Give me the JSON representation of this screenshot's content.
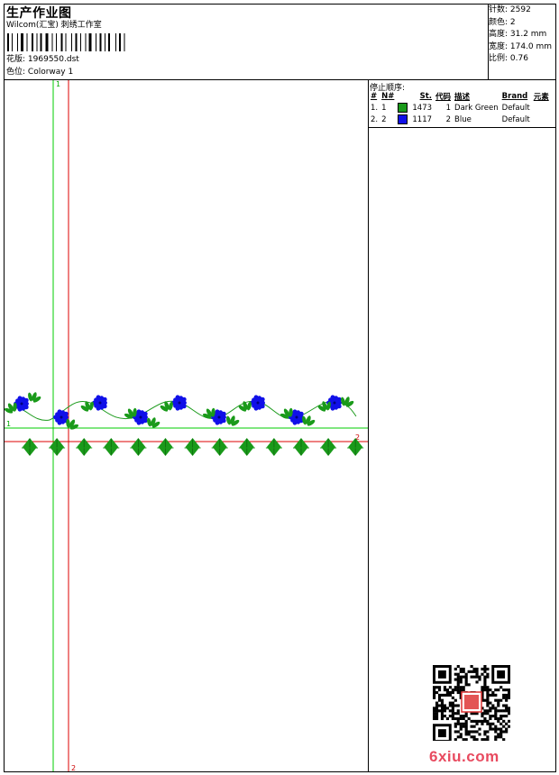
{
  "header": {
    "title": "生产作业图",
    "company": "Wilcom(汇宝) 刺绣工作室",
    "design_label": "花版:",
    "design_value": "1969550.dst",
    "colorway_label": "色位:",
    "colorway_value": "Colorway 1"
  },
  "stats": {
    "stitches": "针数: 2592",
    "colors": "颜色: 2",
    "height": "高度: 31.2 mm",
    "width": "宽度: 174.0 mm",
    "scale": "比例: 0.76"
  },
  "stop_sequence": {
    "title": "停止顺序:",
    "headers": [
      "#",
      "N#",
      "St.",
      "代码",
      "描述",
      "Brand",
      "元素"
    ],
    "rows": [
      {
        "num": "1.",
        "needle": "1",
        "color": "#1a9a1a",
        "stitches": "1473",
        "code": "1",
        "desc": "Dark Green",
        "brand": "Default"
      },
      {
        "num": "2.",
        "needle": "2",
        "color": "#1010e8",
        "stitches": "1117",
        "code": "2",
        "desc": "Blue",
        "brand": "Default"
      }
    ]
  },
  "guides": {
    "green_v_label": "1",
    "red_v_label": "2",
    "green_h_label": "1",
    "red_h_label": "2"
  },
  "colors": {
    "leaf": "#1a9a1a",
    "flower": "#1010e8",
    "guide_green": "#00cc00",
    "guide_red": "#dd0000"
  },
  "watermark": "6xiu.com"
}
